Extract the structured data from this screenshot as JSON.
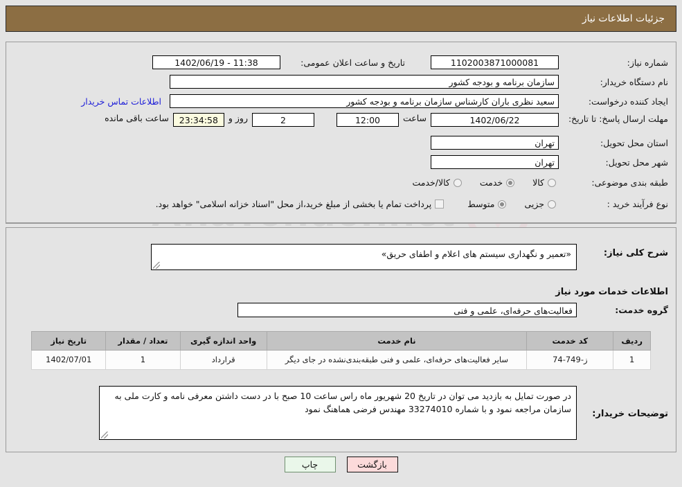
{
  "header": {
    "title": "جزئیات اطلاعات نیاز"
  },
  "watermark": {
    "text": "AnaTender.net"
  },
  "summary": {
    "need_number_label": "شماره نیاز:",
    "need_number_value": "1102003871000081",
    "announce_datetime_label": "تاریخ و ساعت اعلان عمومی:",
    "announce_datetime_value": "11:38 - 1402/06/19",
    "buyer_org_label": "نام دستگاه خریدار:",
    "buyer_org_value": "سازمان برنامه و بودجه کشور",
    "empty_field_value": "",
    "requester_label": "ایجاد کننده درخواست:",
    "requester_value": "سعید نظری باران کارشناس سازمان برنامه و بودجه کشور",
    "contact_link": "اطلاعات تماس خریدار",
    "deadline_label": "مهلت ارسال پاسخ: تا تاریخ:",
    "deadline_date": "1402/06/22",
    "deadline_time_label": "ساعت",
    "deadline_time": "12:00",
    "days_remaining": "2",
    "days_word": "روز و",
    "countdown": "23:34:58",
    "countdown_suffix": "ساعت باقی مانده",
    "province_label": "استان محل تحویل:",
    "province_value": "تهران",
    "city_label": "شهر محل تحویل:",
    "city_value": "تهران",
    "category_label": "طبقه بندی موضوعی:",
    "category_options": [
      {
        "label": "کالا",
        "selected": false
      },
      {
        "label": "خدمت",
        "selected": true
      },
      {
        "label": "کالا/خدمت",
        "selected": false
      }
    ],
    "process_label": "نوع فرآیند خرید :",
    "process_options": [
      {
        "label": "جزیی",
        "selected": false
      },
      {
        "label": "متوسط",
        "selected": true
      }
    ],
    "treasury_checkbox_checked": false,
    "treasury_text": "پرداخت تمام یا بخشی از مبلغ خرید،از محل \"اسناد خزانه اسلامی\" خواهد بود."
  },
  "details": {
    "need_desc_label": "شرح کلی نیاز:",
    "need_desc_value": "«تعمیر و نگهداری سیستم های اعلام و اطفای حریق»",
    "services_section_title": "اطلاعات خدمات مورد نیاز",
    "service_group_label": "گروه خدمت:",
    "service_group_value": "فعالیت‌های حرفه‌ای، علمی و فنی"
  },
  "table": {
    "headers": [
      "ردیف",
      "کد خدمت",
      "نام خدمت",
      "واحد اندازه گیری",
      "تعداد / مقدار",
      "تاریخ نیاز"
    ],
    "rows": [
      {
        "row_no": "1",
        "service_code": "ز-749-74",
        "service_name": "سایر فعالیت‌های حرفه‌ای، علمی و فنی طبقه‌بندی‌نشده در جای دیگر",
        "unit": "قرارداد",
        "quantity": "1",
        "need_date": "1402/07/01"
      }
    ]
  },
  "buyer_notes": {
    "label": "توضیحات خریدار:",
    "value": "در صورت تمایل به بازدید می توان در تاریخ 20 شهریور ماه راس ساعت 10 صبح با در دست داشتن معرفی نامه و کارت ملی به سازمان مراجعه نمود و با شماره 33274010 مهندس فرضی هماهنگ نمود"
  },
  "footer": {
    "print_label": "چاپ",
    "back_label": "بازگشت"
  },
  "colors": {
    "header_bar": "#8c6e43",
    "page_bg": "#e4e4e4",
    "link": "#2020d8",
    "table_header": "#c3c3c3",
    "print_btn_bg": "#eaf7ea",
    "back_btn_bg": "#fcdada",
    "countdown_bg": "#fbfbe0"
  }
}
